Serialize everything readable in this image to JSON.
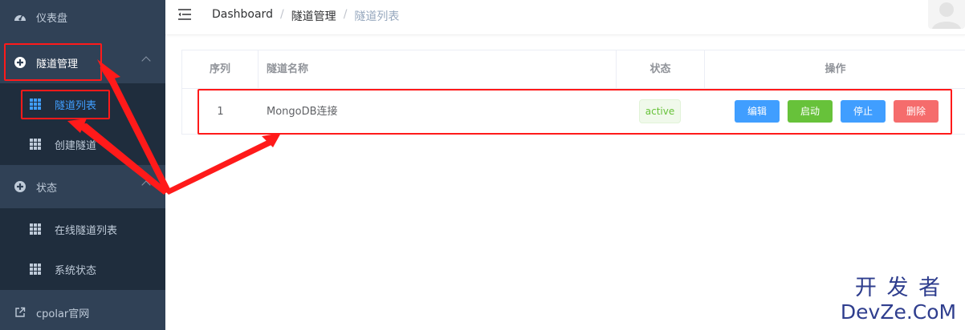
{
  "sidebar": {
    "items": [
      {
        "label": "仪表盘",
        "icon": "dashboard-icon"
      },
      {
        "label": "隧道管理",
        "icon": "tunnel-management-icon",
        "expanded": true,
        "children": [
          {
            "label": "隧道列表",
            "icon": "grid-icon",
            "active": true
          },
          {
            "label": "创建隧道",
            "icon": "grid-icon"
          }
        ]
      },
      {
        "label": "状态",
        "icon": "status-icon",
        "expanded": true,
        "children": [
          {
            "label": "在线隧道列表",
            "icon": "grid-icon"
          },
          {
            "label": "系统状态",
            "icon": "grid-icon"
          }
        ]
      },
      {
        "label": "cpolar官网",
        "icon": "external-link-icon"
      }
    ]
  },
  "header": {
    "breadcrumb": [
      "Dashboard",
      "隧道管理",
      "隧道列表"
    ],
    "separator": "/"
  },
  "table": {
    "columns": [
      "序列",
      "隧道名称",
      "状态",
      "操作"
    ],
    "rows": [
      {
        "index": "1",
        "name": "MongoDB连接",
        "status": "active",
        "actions": [
          "编辑",
          "启动",
          "停止",
          "删除"
        ]
      }
    ]
  },
  "watermark": {
    "line1": "开 发 者",
    "line2": "DevZe.CoM"
  },
  "colors": {
    "sidebar_bg": "#304156",
    "submenu_bg": "#1f2d3d",
    "active": "#409eff",
    "edit": "#409eff",
    "start": "#67c23a",
    "stop": "#409eff",
    "delete": "#f56c6c",
    "annotation": "#ff1a1a"
  }
}
